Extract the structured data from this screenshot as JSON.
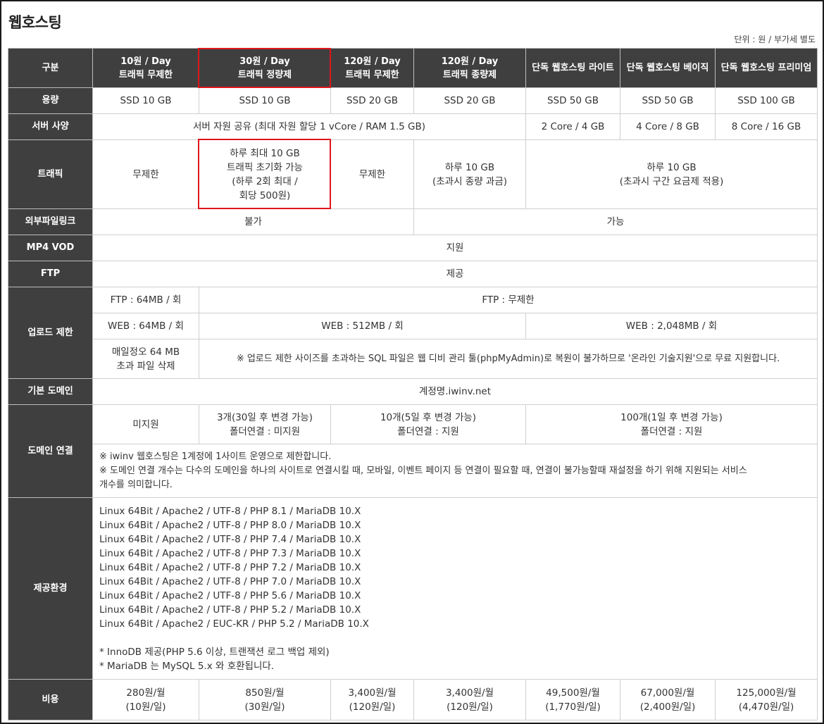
{
  "title": "웹호스팅",
  "unit_note": "단위 : 원 / 부가세 별도",
  "highlight_color": "#e0151c",
  "header": {
    "label": "구분",
    "plans": [
      {
        "line1": "10원 / Day",
        "line2": "트래픽 무제한"
      },
      {
        "line1": "30원 / Day",
        "line2": "트래픽 정량제"
      },
      {
        "line1": "120원 / Day",
        "line2": "트래픽 무제한"
      },
      {
        "line1": "120원 / Day",
        "line2": "트래픽 종량제"
      },
      {
        "line1": "단독 웹호스팅 라이트",
        "line2": ""
      },
      {
        "line1": "단독 웹호스팅 베이직",
        "line2": ""
      },
      {
        "line1": "단독 웹호스팅 프리미엄",
        "line2": ""
      }
    ]
  },
  "rows": {
    "capacity": {
      "label": "용량",
      "values": [
        "SSD 10 GB",
        "SSD 10 GB",
        "SSD 20 GB",
        "SSD 20 GB",
        "SSD 50 GB",
        "SSD 50 GB",
        "SSD 100 GB"
      ]
    },
    "server": {
      "label": "서버 사양",
      "shared": "서버 자원 공유 (최대 자원 할당 1 vCore / RAM 1.5 GB)",
      "lite": "2 Core / 4 GB",
      "basic": "4 Core / 8 GB",
      "premium": "8 Core / 16 GB"
    },
    "traffic": {
      "label": "트래픽",
      "p1": "무제한",
      "p2": [
        "하루 최대 10 GB",
        "트래픽 초기화 가능",
        "(하루 2회 최대 /",
        "회당 500원)"
      ],
      "p3": "무제한",
      "p4": [
        "하루 10 GB",
        "(초과시 종량 과금)"
      ],
      "dedicated": [
        "하루 10 GB",
        "(초과시 구간 요금제 적용)"
      ]
    },
    "external_link": {
      "label": "외부파일링크",
      "left": "불가",
      "right": "가능"
    },
    "mp4": {
      "label": "MP4 VOD",
      "value": "지원"
    },
    "ftp": {
      "label": "FTP",
      "value": "제공"
    },
    "upload": {
      "label": "업로드 제한",
      "ftp_p1": "FTP : 64MB / 회",
      "ftp_rest": "FTP : 무제한",
      "web_p1": "WEB : 64MB / 회",
      "web_mid": "WEB : 512MB / 회",
      "web_ded": "WEB : 2,048MB / 회",
      "delete_p1": [
        "매일정오 64 MB",
        "초과 파일 삭제"
      ],
      "sql_note": "※ 업로드 제한 사이즈를 초과하는 SQL 파일은 웹 디비 관리 툴(phpMyAdmin)로 복원이 불가하므로 '온라인 기술지원'으로 무료 지원합니다."
    },
    "domain": {
      "label": "기본 도메인",
      "value": "계정명.iwinv.net"
    },
    "domain_link": {
      "label": "도메인 연결",
      "p1": "미지원",
      "p2": [
        "3개(30일 후 변경 가능)",
        "폴더연결 : 미지원"
      ],
      "p34": [
        "10개(5일 후 변경 가능)",
        "폴더연결 : 지원"
      ],
      "dedicated": [
        "100개(1일 후 변경 가능)",
        "폴더연결 : 지원"
      ],
      "notes": [
        "※ iwinv 웹호스팅은 1계정에 1사이트 운영으로 제한합니다.",
        "※ 도메인 연결 개수는 다수의 도메인을 하나의 사이트로 연결시킬 때, 모바일, 이벤트 페이지 등 연결이 필요할 때, 연결이 불가능할때 재설정을 하기 위해 지원되는 서비스",
        "개수를 의미합니다."
      ]
    },
    "env": {
      "label": "제공환경",
      "lines": [
        "Linux 64Bit / Apache2 / UTF-8 / PHP 8.1 / MariaDB 10.X",
        "Linux 64Bit / Apache2 / UTF-8 / PHP 8.0 / MariaDB 10.X",
        "Linux 64Bit / Apache2 / UTF-8 / PHP 7.4 / MariaDB 10.X",
        "Linux 64Bit / Apache2 / UTF-8 / PHP 7.3 / MariaDB 10.X",
        "Linux 64Bit / Apache2 / UTF-8 / PHP 7.2 / MariaDB 10.X",
        "Linux 64Bit / Apache2 / UTF-8 / PHP 7.0 / MariaDB 10.X",
        "Linux 64Bit / Apache2 / UTF-8 / PHP 5.6 / MariaDB 10.X",
        "Linux 64Bit / Apache2 / UTF-8 / PHP 5.2 / MariaDB 10.X",
        "Linux 64Bit / Apache2 / EUC-KR / PHP 5.2 / MariaDB 10.X"
      ],
      "notes": [
        "* InnoDB 제공(PHP 5.6 이상, 트랜잭션 로그 백업 제외)",
        "* MariaDB 는 MySQL 5.x 와 호환됩니다."
      ]
    },
    "cost": {
      "label": "비용",
      "values": [
        [
          "280원/월",
          "(10원/일)"
        ],
        [
          "850원/월",
          "(30원/일)"
        ],
        [
          "3,400원/월",
          "(120원/일)"
        ],
        [
          "3,400원/월",
          "(120원/일)"
        ],
        [
          "49,500원/월",
          "(1,770원/일)"
        ],
        [
          "67,000원/월",
          "(2,400원/일)"
        ],
        [
          "125,000원/월",
          "(4,470원/일)"
        ]
      ]
    }
  }
}
